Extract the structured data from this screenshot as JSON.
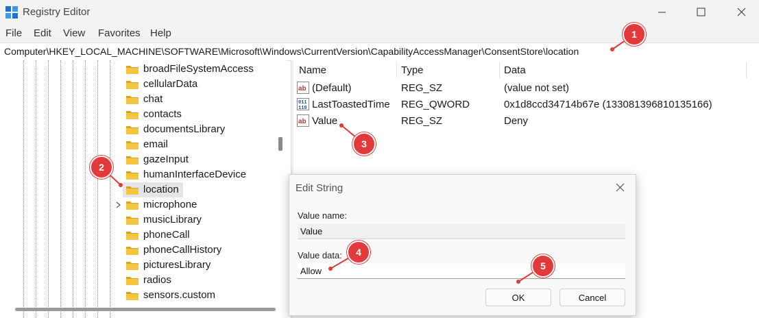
{
  "window": {
    "title": "Registry Editor",
    "controls": [
      "minimize-icon",
      "maximize-icon",
      "close-icon"
    ]
  },
  "menu": {
    "items": [
      "File",
      "Edit",
      "View",
      "Favorites",
      "Help"
    ]
  },
  "address_bar": {
    "path": "Computer\\HKEY_LOCAL_MACHINE\\SOFTWARE\\Microsoft\\Windows\\CurrentVersion\\CapabilityAccessManager\\ConsentStore\\location"
  },
  "tree": {
    "items": [
      {
        "label": "broadFileSystemAccess"
      },
      {
        "label": "cellularData"
      },
      {
        "label": "chat"
      },
      {
        "label": "contacts"
      },
      {
        "label": "documentsLibrary"
      },
      {
        "label": "email"
      },
      {
        "label": "gazeInput"
      },
      {
        "label": "humanInterfaceDevice"
      },
      {
        "label": "location",
        "selected": true
      },
      {
        "label": "microphone",
        "expandable": true
      },
      {
        "label": "musicLibrary"
      },
      {
        "label": "phoneCall"
      },
      {
        "label": "phoneCallHistory"
      },
      {
        "label": "picturesLibrary"
      },
      {
        "label": "radios"
      },
      {
        "label": "sensors.custom"
      }
    ]
  },
  "values_list": {
    "columns": [
      "Name",
      "Type",
      "Data"
    ],
    "rows": [
      {
        "name": "(Default)",
        "type": "REG_SZ",
        "data": "(value not set)",
        "icon": "string-value-icon"
      },
      {
        "name": "LastToastedTime",
        "type": "REG_QWORD",
        "data": "0x1d8ccd34714b67e (133081396810135166)",
        "icon": "binary-value-icon"
      },
      {
        "name": "Value",
        "type": "REG_SZ",
        "data": "Deny",
        "icon": "string-value-icon"
      }
    ]
  },
  "dialog": {
    "title": "Edit String",
    "value_name_label": "Value name:",
    "value_name": "Value",
    "value_data_label": "Value data:",
    "value_data": "Allow",
    "ok_label": "OK",
    "cancel_label": "Cancel"
  },
  "callouts": [
    "1",
    "2",
    "3",
    "4",
    "5"
  ],
  "colors": {
    "callout": "#e23a3a",
    "selection": "#e5e5e5",
    "folder": "#f4c542"
  }
}
